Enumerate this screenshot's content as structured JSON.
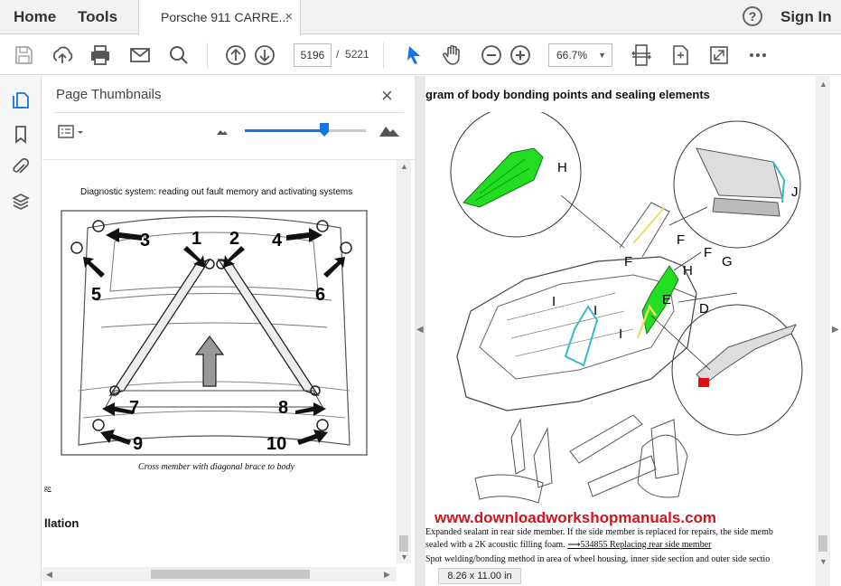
{
  "topbar": {
    "home_label": "Home",
    "tools_label": "Tools",
    "doc_tab_title": "Porsche 911 CARRE...",
    "close_glyph": "×",
    "help_glyph": "?",
    "signin_label": "Sign In"
  },
  "toolbar": {
    "current_page": "5196",
    "page_separator": "/",
    "total_pages": "5221",
    "zoom_value": "66.7%",
    "icons": [
      "save-icon",
      "upload-icon",
      "print-icon",
      "email-icon",
      "search-icon",
      "page-up-icon",
      "page-down-icon",
      "select-pointer-icon",
      "hand-icon",
      "zoom-out-icon",
      "zoom-in-icon",
      "fit-page-icon",
      "rotate-icon",
      "fullscreen-icon",
      "more-icon"
    ]
  },
  "left_rail": {
    "icons": [
      "page-thumbnails-icon",
      "bookmark-icon",
      "attachment-icon",
      "layers-icon"
    ]
  },
  "panel": {
    "title": "Page Thumbnails",
    "close_glyph": "×",
    "slider_level": 0.66
  },
  "thumbnail_page": {
    "header": "Diagnostic system: reading out fault memory and activating systems",
    "caption": "Cross member with diagonal brace to body",
    "link_fragment": "ge",
    "section_fragment": "llation",
    "callouts": [
      "1",
      "2",
      "3",
      "4",
      "5",
      "6",
      "7",
      "8",
      "9",
      "10"
    ]
  },
  "viewer": {
    "heading": "gram of body bonding points and sealing elements",
    "callouts": [
      "H",
      "J",
      "F",
      "F",
      "F",
      "H",
      "G",
      "E",
      "D",
      "I",
      "I",
      "I"
    ],
    "watermark": "www.downloadworkshopmanuals.com",
    "line1": "Expanded sealant in rear side member. If the side member is replaced for repairs, the side memb",
    "line2_pre": "sealed with a 2K acoustic filling foam. ",
    "line2_link": "⟶534855 Replacing rear side member",
    "line3": "Spot welding/bonding method in area of wheel housing, inner side section and outer side sectio",
    "page_size": "8.26 x 11.00 in"
  },
  "colors": {
    "accent": "#1473e6",
    "watermark": "#d2141e",
    "highlight_green": "#22dd22",
    "highlight_cyan": "#33bbcc",
    "highlight_yellow": "#e8e060",
    "highlight_red": "#dd1111"
  }
}
